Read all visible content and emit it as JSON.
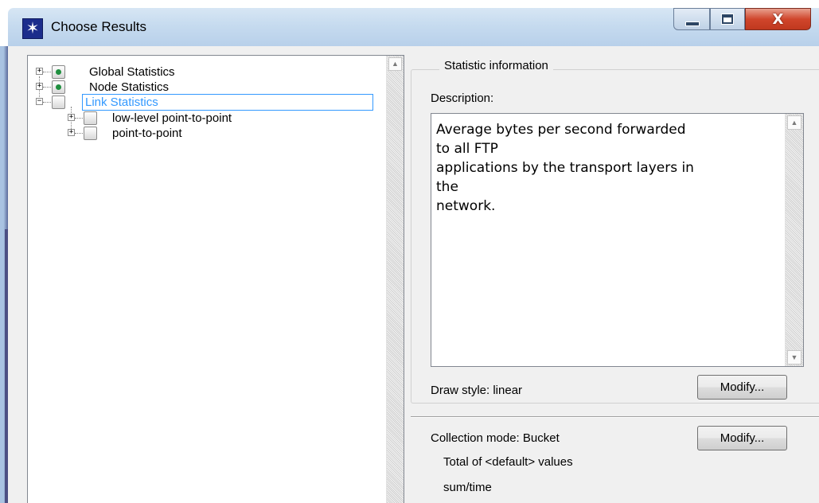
{
  "window": {
    "title": "Choose Results",
    "icon": "star-burst-icon",
    "controls": {
      "minimize": "minimize-icon",
      "maximize": "maximize-icon",
      "close_label": "X"
    }
  },
  "tree": {
    "items": [
      {
        "label": "Global Statistics",
        "expander": "+",
        "status": "green-dot-icon"
      },
      {
        "label": "Node Statistics",
        "expander": "+",
        "status": "green-dot-icon"
      },
      {
        "label": "Link Statistics",
        "expander": "−",
        "status": "empty-box-icon",
        "selected": true
      },
      {
        "label": "low-level point-to-point",
        "expander": "+",
        "status": "empty-box-icon"
      },
      {
        "label": "point-to-point",
        "expander": "+",
        "status": "empty-box-icon"
      }
    ],
    "scroll_up": "▲"
  },
  "info": {
    "group_title": "Statistic information",
    "description_label": "Description:",
    "description_text": "Average bytes per second forwarded\nto all FTP\napplications by the transport layers in\nthe\nnetwork.",
    "draw_style": "Draw style: linear",
    "modify_label": "Modify...",
    "collection_mode": "Collection mode: Bucket",
    "collection_modify_label": "Modify...",
    "total_of": "Total of <default> values",
    "sum_time": "sum/time",
    "scroll_up": "▲",
    "scroll_down": "▼"
  },
  "colors": {
    "selection_border": "#3399ff",
    "status_green": "#1f8f3f",
    "close_red": "#c0391f"
  }
}
